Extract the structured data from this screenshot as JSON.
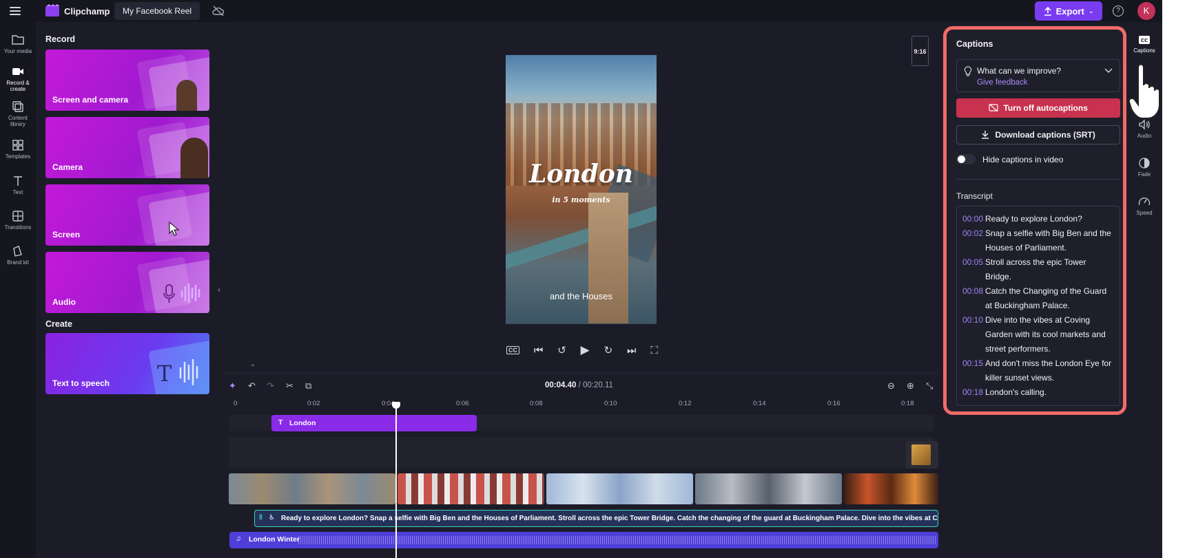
{
  "app": {
    "name": "Clipchamp",
    "project_title": "My Facebook Reel"
  },
  "header": {
    "export_label": "Export",
    "avatar_initial": "K",
    "help": "?"
  },
  "left_rail": [
    {
      "label": "Your media"
    },
    {
      "label": "Record & create"
    },
    {
      "label": "Content library"
    },
    {
      "label": "Templates"
    },
    {
      "label": "Text"
    },
    {
      "label": "Transitions"
    },
    {
      "label": "Brand kit"
    }
  ],
  "record_panel": {
    "record_heading": "Record",
    "create_heading": "Create",
    "cards": [
      "Screen and camera",
      "Camera",
      "Screen",
      "Audio"
    ],
    "create_cards": [
      "Text to speech"
    ]
  },
  "preview": {
    "aspect_ratio": "9:16",
    "title_overlay": "London",
    "subtitle_overlay": "in 5 moments",
    "caption_overlay": "and the Houses"
  },
  "timeline": {
    "current_time": "00:04.40",
    "total_time": "/ 00:20.11",
    "ticks": [
      "0",
      "0:02",
      "0:04",
      "0:06",
      "0:08",
      "0:10",
      "0:12",
      "0:14",
      "0:16",
      "0:18"
    ],
    "text_clip_label": "London",
    "caption_clip_text": "Ready to explore London? Snap a selfie with Big Ben and the Houses of Parliament. Stroll across the epic Tower Bridge. Catch the changing of the guard at Buckingham Palace. Dive into the vibes at C",
    "audio_clip_label": "London Winter"
  },
  "captions_panel": {
    "title": "Captions",
    "feedback_question": "What can we improve?",
    "feedback_link": "Give feedback",
    "autocaptions_button": "Turn off autocaptions",
    "download_button": "Download captions (SRT)",
    "hide_captions_label": "Hide captions in video",
    "hide_captions_on": false,
    "transcript_heading": "Transcript",
    "transcript": [
      {
        "time": "00:00",
        "text": "Ready to explore London?"
      },
      {
        "time": "00:02",
        "text": "Snap a selfie with Big Ben and the Houses of Parliament."
      },
      {
        "time": "00:05",
        "text": "Stroll across the epic Tower Bridge."
      },
      {
        "time": "00:08",
        "text": "Catch the Changing of the Guard at Buckingham Palace."
      },
      {
        "time": "00:10",
        "text": "Dive into the vibes at Coving Garden with its cool markets and street performers."
      },
      {
        "time": "00:15",
        "text": "And don't miss the London Eye for killer sunset views."
      },
      {
        "time": "00:18",
        "text": "London's calling."
      }
    ]
  },
  "right_rail": [
    {
      "label": "Captions"
    },
    {
      "label": "Audio"
    },
    {
      "label": "Fade"
    },
    {
      "label": "Speed"
    }
  ],
  "colors": {
    "accent": "#7a3cf0",
    "highlight_border": "#f26b68",
    "danger": "#c8324e",
    "card_gradient": "#c419d8"
  }
}
